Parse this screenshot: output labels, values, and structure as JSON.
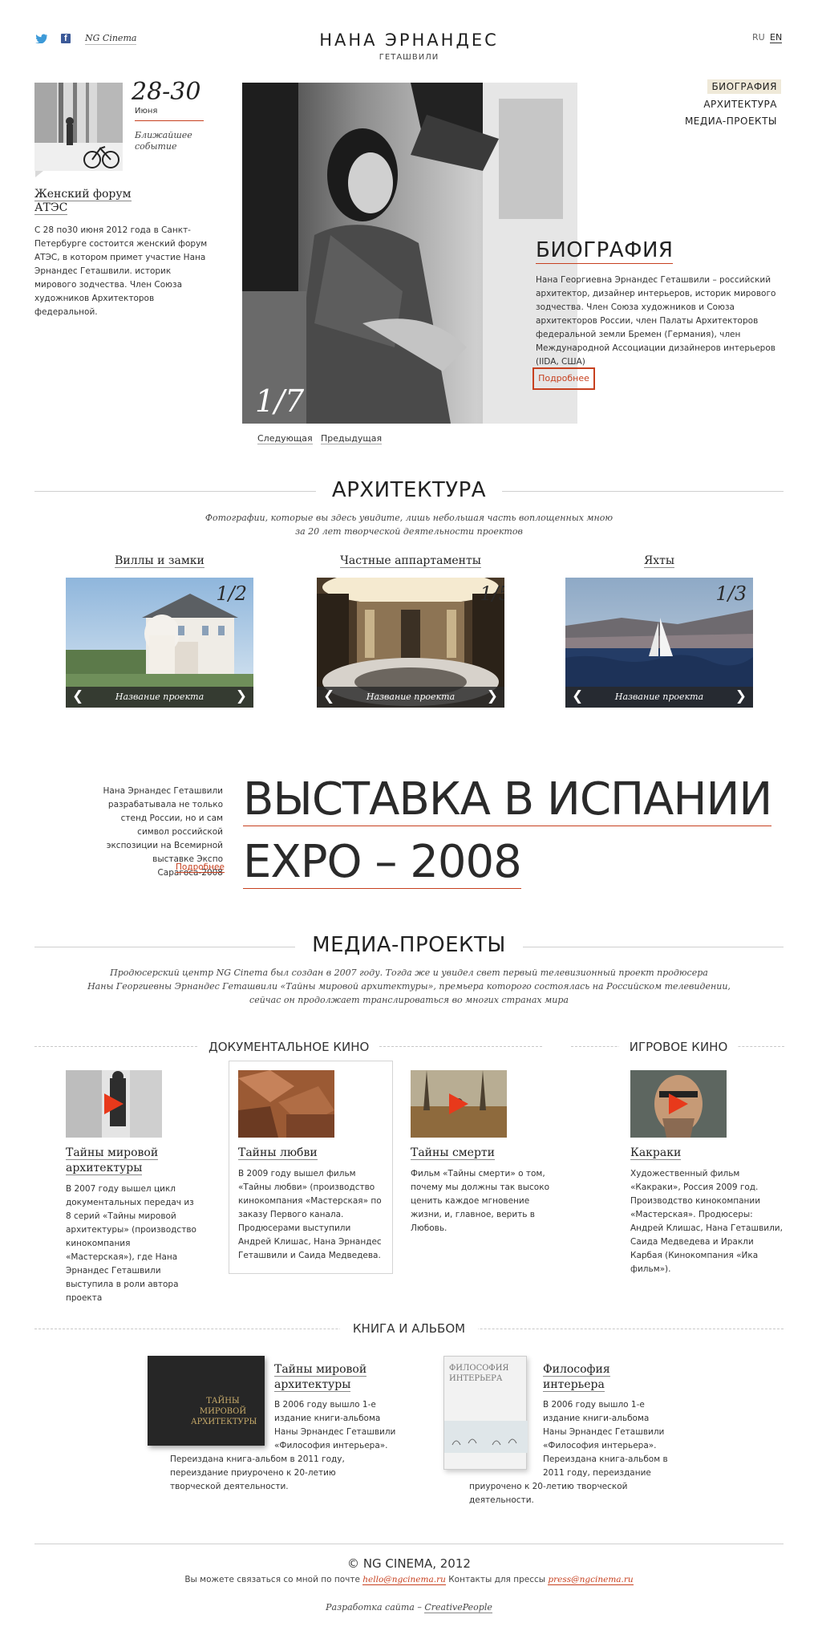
{
  "header": {
    "social": {
      "twitter_icon": "twitter-icon",
      "facebook_icon": "facebook-icon",
      "ng_link": "NG Cinema"
    },
    "site_title": "НАНА ЭРНАНДЕС",
    "site_subtitle": "ГЕТАШВИЛИ",
    "lang": {
      "ru": "RU",
      "en": "EN"
    }
  },
  "nav": {
    "items": [
      "БИОГРАФИЯ",
      "АРХИТЕКТУРА",
      "МЕДИА-ПРОЕКТЫ"
    ]
  },
  "event": {
    "date": "28-30",
    "month": "Июня",
    "label": "Ближайшее событие",
    "title": "Женский форум АТЭС",
    "text": "С 28 по30 июня 2012 года в Санкт-Петербурге состоится женский форум АТЭС, в котором примет участие Нана Эрнандес Геташвили.  историк мирового зодчества.  Член Союза художников Архитекторов федеральной."
  },
  "hero": {
    "counter": "1/7",
    "next": "Следующая",
    "prev": "Предыдущая",
    "bio_title": "БИОГРАФИЯ",
    "bio_text": "Нана Георгиевна Эрнандес Геташвили – российский архитектор, дизайнер интерьеров, историк мирового зодчества.  Член Союза художников и Союза архитекторов России, член Палаты Архитекторов федеральной земли Бремен (Германия), член Международной Ассоциации дизайнеров интерьеров (IIDA, США)",
    "more": "Подробнее"
  },
  "architecture": {
    "title": "АРХИТЕКТУРА",
    "subtitle_line1": "Фотографии, которые вы здесь увидите, лишь небольшая часть воплощенных мною",
    "subtitle_line2": "за 20 лет творческой деятельности проектов",
    "galleries": [
      {
        "title": "Виллы и замки",
        "counter": "1/2",
        "caption": "Название проекта"
      },
      {
        "title": "Частные аппартаменты",
        "counter": "1/5",
        "caption": "Название проекта"
      },
      {
        "title": "Яхты",
        "counter": "1/3",
        "caption": "Название проекта"
      }
    ]
  },
  "expo": {
    "text": "Нана Эрнандес Геташвили разрабатывала не только стенд России, но и сам символ российской экспозиции на Всемирной выставке Экспо Сарагоса-2008",
    "more": "Подробнее",
    "headline1": "ВЫСТАВКА В ИСПАНИИ",
    "headline2": "EXPO – 2008"
  },
  "media": {
    "title": "МЕДИА-ПРОЕКТЫ",
    "subtitle_line1": "Продюсерский центр NG Cinema был создан в 2007 году. Тогда же и увидел свет первый телевизионный проект продюсера",
    "subtitle_line2": "Наны Георгиевны Эрнандес Геташвили «Тайны мировой архитектуры», премьера которого состоялась на Российском телевидении,",
    "subtitle_line3": "сейчас он продолжает транслироваться во многих странах мира",
    "doc_heading": "ДОКУМЕНТАЛЬНОЕ КИНО",
    "game_heading": "ИГРОВОЕ КИНО",
    "films": [
      {
        "title": "Тайны мировой архитектуры",
        "text": "В 2007 году вышел цикл документальных передач из 8 серий «Тайны мировой архитектуры» (производство кинокомпания «Мастерская»), где Нана Эрнандес Геташвили выступила в роли автора проекта"
      },
      {
        "title": "Тайны любви",
        "text": "В 2009 году вышел фильм «Тайны любви» (производство кинокомпания «Мастерская» по заказу Первого канала. Продюсерами выступили Андрей Клишас, Нана Эрнандес Геташвили и Саида Медведева."
      },
      {
        "title": "Тайны смерти",
        "text": "Фильм «Тайны смерти» о том, почему мы должны так высоко ценить каждое мгновение жизни, и, главное, верить в Любовь."
      },
      {
        "title": "Какраки",
        "text": "Художественный фильм «Какраки», Россия 2009 год. Производство кинокомпании «Мастерская». Продюсеры: Андрей Клишас, Нана Геташвили, Саида Медведева и Иракли Карбая (Кинокомпания «Ика фильм»)."
      }
    ]
  },
  "books": {
    "heading": "КНИГА И АЛЬБОМ",
    "items": [
      {
        "title": "Тайны мировой архитектуры",
        "cover": "ТАЙНЫ МИРОВОЙ АРХИТЕКТУРЫ",
        "text_a": "В 2006 году вышло 1-е издание книги-альбома Наны Эрнандес Геташвили «Философия интерьера».",
        "text_b": "Переиздана книга-альбом в 2011 году, переиздание приурочено к 20-летию творческой деятельности."
      },
      {
        "title": "Философия интерьера",
        "cover": "ФИЛОСОФИЯ ИНТЕРЬЕРА",
        "text_a": "В 2006 году вышло 1-е издание книги-альбома Наны Эрнандес Геташвили «Философия интерьера». Переиздана книга-альбом в 2011 году, переиздание",
        "text_b": "приурочено к 20-летию творческой деятельности."
      }
    ]
  },
  "footer": {
    "copyright": "© NG CINEMA, 2012",
    "contact_prefix": "Вы можете связаться со мной по почте",
    "email": "hello@ngcinema.ru",
    "press_prefix": "Контакты для прессы",
    "press_email": "press@ngcinema.ru",
    "dev_prefix": "Разработка сайта –",
    "dev_name": "CreativePeople"
  },
  "colors": {
    "accent": "#c7401f",
    "play": "#e8391b",
    "text": "#2a2a2a",
    "rule": "#cfcfcf",
    "nav_active_bg": "#efe9d8"
  }
}
